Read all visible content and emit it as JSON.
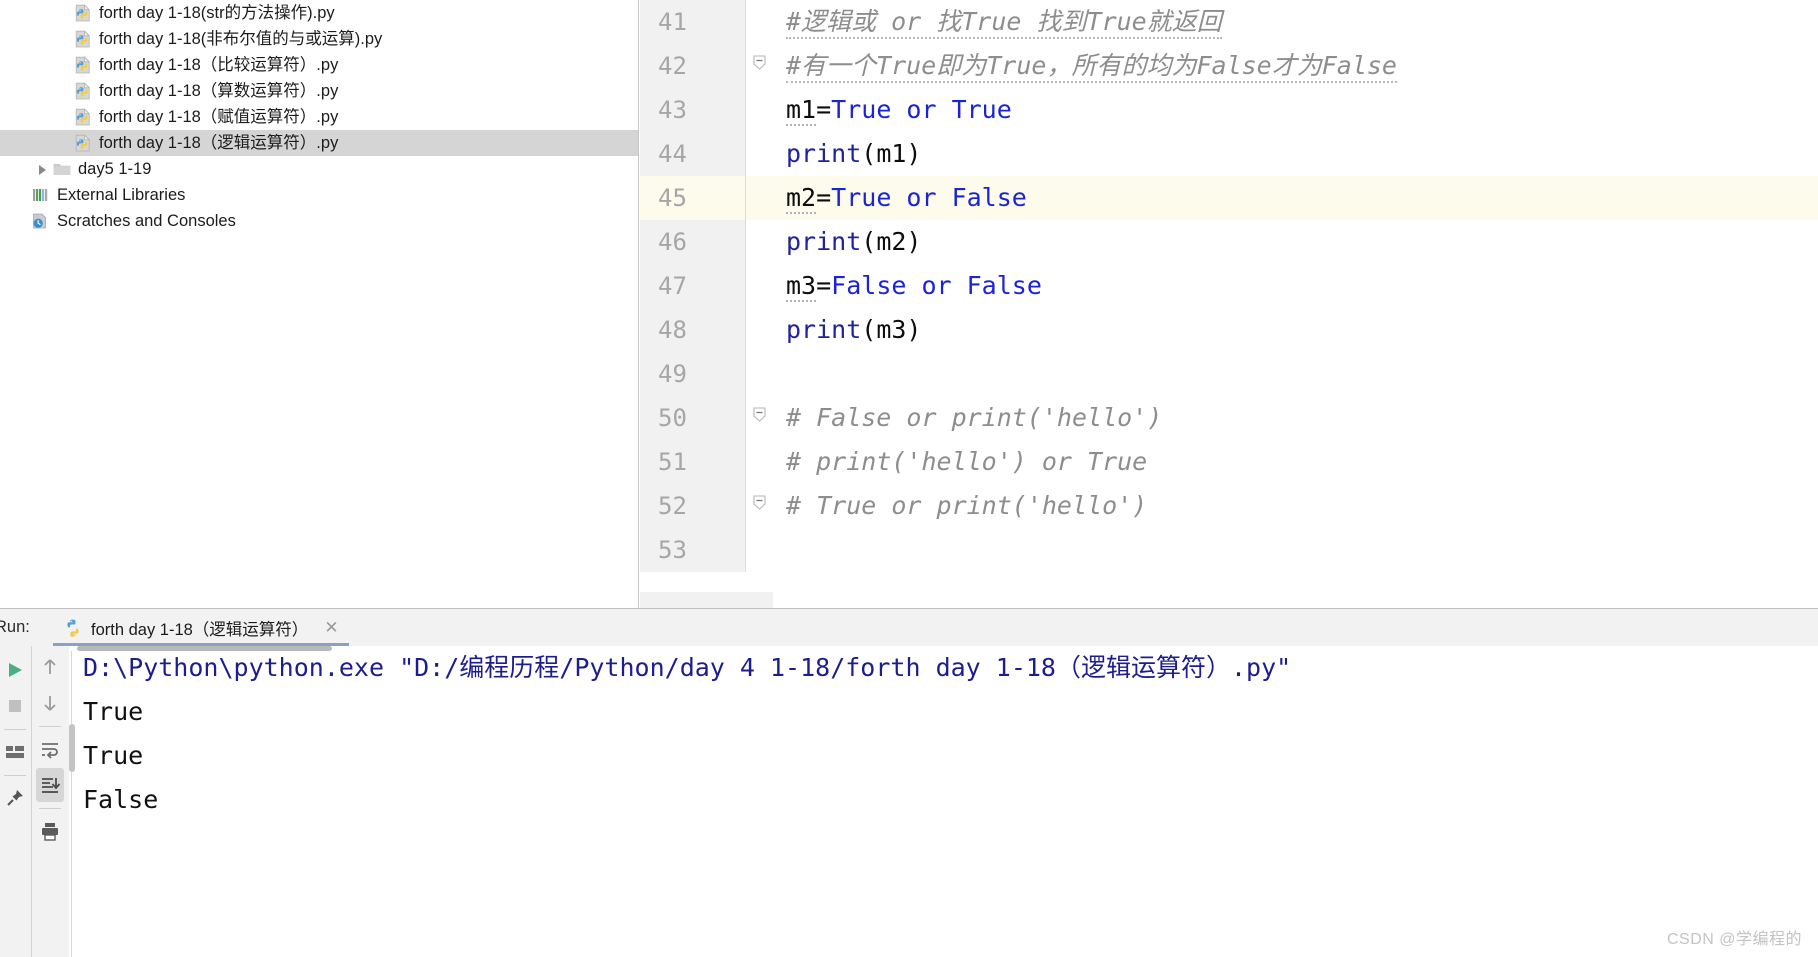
{
  "project_tree": {
    "items": [
      {
        "label": "forth day 1-18(str的方法操作).py",
        "icon": "python-file-icon",
        "indent": 2,
        "selected": false,
        "expandable": false
      },
      {
        "label": "forth day 1-18(非布尔值的与或运算).py",
        "icon": "python-file-icon",
        "indent": 2,
        "selected": false,
        "expandable": false
      },
      {
        "label": "forth day 1-18（比较运算符）.py",
        "icon": "python-file-icon",
        "indent": 2,
        "selected": false,
        "expandable": false
      },
      {
        "label": "forth day 1-18（算数运算符）.py",
        "icon": "python-file-icon",
        "indent": 2,
        "selected": false,
        "expandable": false
      },
      {
        "label": "forth day 1-18（赋值运算符）.py",
        "icon": "python-file-icon",
        "indent": 2,
        "selected": false,
        "expandable": false
      },
      {
        "label": "forth day 1-18（逻辑运算符）.py",
        "icon": "python-file-icon",
        "indent": 2,
        "selected": true,
        "expandable": false
      },
      {
        "label": "day5 1-19",
        "icon": "folder-icon",
        "indent": 1,
        "selected": false,
        "expandable": true
      },
      {
        "label": "External Libraries",
        "icon": "external-libraries-icon",
        "indent": 0,
        "selected": false,
        "expandable": false
      },
      {
        "label": "Scratches and Consoles",
        "icon": "scratches-icon",
        "indent": 0,
        "selected": false,
        "expandable": false
      }
    ]
  },
  "editor": {
    "current_line": 45,
    "lines": [
      {
        "num": "41",
        "fold": "none",
        "current": false,
        "tokens": [
          {
            "t": "#逻辑或 or 找True 找到True就返回",
            "c": "cmt",
            "squiggle": true
          }
        ]
      },
      {
        "num": "42",
        "fold": "collapse",
        "current": false,
        "tokens": [
          {
            "t": "#有一个True即为True，所有的均为False才为False",
            "c": "cmt",
            "squiggle": true
          }
        ]
      },
      {
        "num": "43",
        "fold": "none",
        "current": false,
        "tokens": [
          {
            "t": "m1",
            "c": "plain",
            "warn": true
          },
          {
            "t": "=",
            "c": "plain"
          },
          {
            "t": "True or True",
            "c": "kw"
          }
        ]
      },
      {
        "num": "44",
        "fold": "none",
        "current": false,
        "tokens": [
          {
            "t": "print",
            "c": "fn"
          },
          {
            "t": "(m1)",
            "c": "plain"
          }
        ]
      },
      {
        "num": "45",
        "fold": "none",
        "current": true,
        "tokens": [
          {
            "t": "m2",
            "c": "plain",
            "warn": true
          },
          {
            "t": "=",
            "c": "plain"
          },
          {
            "t": "True or False",
            "c": "kw"
          }
        ]
      },
      {
        "num": "46",
        "fold": "none",
        "current": false,
        "tokens": [
          {
            "t": "print",
            "c": "fn"
          },
          {
            "t": "(m2)",
            "c": "plain"
          }
        ]
      },
      {
        "num": "47",
        "fold": "none",
        "current": false,
        "tokens": [
          {
            "t": "m3",
            "c": "plain",
            "warn": true
          },
          {
            "t": "=",
            "c": "plain"
          },
          {
            "t": "False or False",
            "c": "kw"
          }
        ]
      },
      {
        "num": "48",
        "fold": "none",
        "current": false,
        "tokens": [
          {
            "t": "print",
            "c": "fn"
          },
          {
            "t": "(m3)",
            "c": "plain"
          }
        ]
      },
      {
        "num": "49",
        "fold": "none",
        "current": false,
        "tokens": []
      },
      {
        "num": "50",
        "fold": "collapse",
        "current": false,
        "tokens": [
          {
            "t": "# False or print('hello')",
            "c": "cmt"
          }
        ]
      },
      {
        "num": "51",
        "fold": "none",
        "current": false,
        "tokens": [
          {
            "t": "# print('hello') or True",
            "c": "cmt"
          }
        ]
      },
      {
        "num": "52",
        "fold": "collapse",
        "current": false,
        "tokens": [
          {
            "t": "# True or print('hello')",
            "c": "cmt"
          }
        ]
      },
      {
        "num": "53",
        "fold": "none",
        "current": false,
        "tokens": []
      }
    ]
  },
  "run_panel": {
    "label": "Run:",
    "tab": {
      "title": "forth day 1-18（逻辑运算符）",
      "icon": "python-file-icon",
      "close_icon": "close-icon"
    },
    "toolbar_left": [
      {
        "name": "run-button",
        "icon": "play-icon",
        "active": false
      },
      {
        "name": "stop-button",
        "icon": "stop-icon",
        "active": false
      },
      {
        "name": "layout-button",
        "icon": "layout-icon",
        "active": false
      },
      {
        "name": "pin-button",
        "icon": "pin-icon",
        "active": false
      }
    ],
    "toolbar_right": [
      {
        "name": "prev-occurrence-button",
        "icon": "arrow-up-icon",
        "active": false
      },
      {
        "name": "next-occurrence-button",
        "icon": "arrow-down-icon",
        "active": false
      },
      {
        "name": "soft-wrap-button",
        "icon": "soft-wrap-icon",
        "active": false
      },
      {
        "name": "scroll-to-end-button",
        "icon": "scroll-to-end-icon",
        "active": true
      },
      {
        "name": "print-button",
        "icon": "print-icon",
        "active": false
      }
    ],
    "console": {
      "lines": [
        {
          "text": "D:\\Python\\python.exe \"D:/编程历程/Python/day 4 1-18/forth day 1-18（逻辑运算符）.py\"",
          "kind": "cmd"
        },
        {
          "text": "True",
          "kind": "out"
        },
        {
          "text": "True",
          "kind": "out"
        },
        {
          "text": "False",
          "kind": "out"
        }
      ]
    }
  },
  "watermark": {
    "text": "CSDN @学编程的"
  },
  "colors": {
    "keyword_blue": "#1a24d6",
    "comment_gray": "#8d8d8d",
    "function_blue": "#21239b",
    "current_line_bg": "#fcfbec",
    "gutter_bg": "#f1f1f1",
    "selection_bg": "#d5d5d5",
    "console_text": "#14147a",
    "tab_underline": "#8ca0c4"
  }
}
